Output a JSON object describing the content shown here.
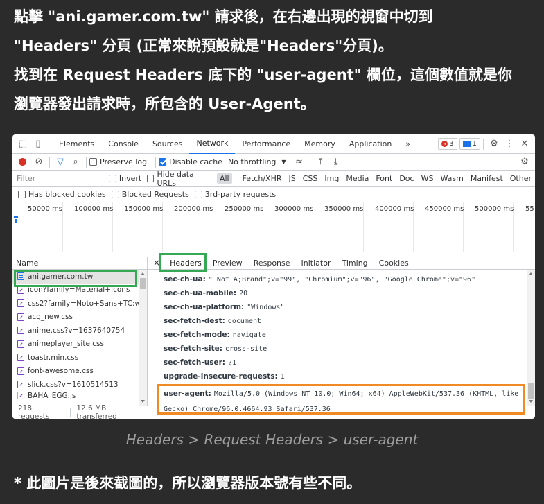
{
  "instructions": [
    "點擊 \"ani.gamer.com.tw\" 請求後，在右邊出現的視窗中切到",
    "\"Headers\" 分頁 (正常來說預設就是\"Headers\"分頁)。",
    "找到在 Request Headers 底下的 \"user-agent\" 欄位，這個數值就是你",
    "瀏覽器發出請求時，所包含的 User-Agent。"
  ],
  "devtools": {
    "tabs": [
      "Elements",
      "Console",
      "Sources",
      "Network",
      "Performance",
      "Memory",
      "Application"
    ],
    "more": "»",
    "active_tab": "Network",
    "error_count": "3",
    "message_count": "1",
    "toolbar": {
      "preserve_log": "Preserve log",
      "disable_cache": "Disable cache",
      "throttling": "No throttling"
    },
    "filter": {
      "placeholder": "Filter",
      "invert": "Invert",
      "hide_data_urls": "Hide data URLs",
      "types": [
        "All",
        "Fetch/XHR",
        "JS",
        "CSS",
        "Img",
        "Media",
        "Font",
        "Doc",
        "WS",
        "Wasm",
        "Manifest",
        "Other"
      ]
    },
    "blocked": {
      "blocked_cookies": "Has blocked cookies",
      "blocked_requests": "Blocked Requests",
      "third_party": "3rd-party requests"
    },
    "timeline_ticks": [
      "50000 ms",
      "100000 ms",
      "150000 ms",
      "200000 ms",
      "250000 ms",
      "300000 ms",
      "350000 ms",
      "400000 ms",
      "450000 ms",
      "500000 ms",
      "55"
    ],
    "name_header": "Name",
    "files": [
      {
        "name": "ani.gamer.com.tw",
        "kind": "doc"
      },
      {
        "name": "icon?family=Material+Icons",
        "kind": "css"
      },
      {
        "name": "css2?family=Noto+Sans+TC:wg",
        "kind": "css"
      },
      {
        "name": "acg_new.css",
        "kind": "css"
      },
      {
        "name": "anime.css?v=1637640754",
        "kind": "css"
      },
      {
        "name": "animeplayer_site.css",
        "kind": "css"
      },
      {
        "name": "toastr.min.css",
        "kind": "css"
      },
      {
        "name": "font-awesome.css",
        "kind": "css"
      },
      {
        "name": "slick.css?v=1610514513",
        "kind": "css"
      },
      {
        "name": "BAHA_EGG.js",
        "kind": "css"
      }
    ],
    "status": {
      "requests": "218 requests",
      "transferred": "12.6 MB transferred"
    },
    "detail_close": "×",
    "detail_tabs": [
      "Headers",
      "Preview",
      "Response",
      "Initiator",
      "Timing",
      "Cookies"
    ],
    "headers": [
      {
        "key": "sec-ch-ua:",
        "value": "\" Not A;Brand\";v=\"99\", \"Chromium\";v=\"96\", \"Google Chrome\";v=\"96\""
      },
      {
        "key": "sec-ch-ua-mobile:",
        "value": "?0"
      },
      {
        "key": "sec-ch-ua-platform:",
        "value": "\"Windows\""
      },
      {
        "key": "sec-fetch-dest:",
        "value": "document"
      },
      {
        "key": "sec-fetch-mode:",
        "value": "navigate"
      },
      {
        "key": "sec-fetch-site:",
        "value": "cross-site"
      },
      {
        "key": "sec-fetch-user:",
        "value": "?1"
      },
      {
        "key": "upgrade-insecure-requests:",
        "value": "1"
      }
    ],
    "user_agent": {
      "key": "user-agent:",
      "value": "Mozilla/5.0 (Windows NT 10.0; Win64; x64) AppleWebKit/537.36 (KHTML, like Gecko) Chrome/96.0.4664.93 Safari/537.36"
    }
  },
  "caption": "Headers > Request Headers > user-agent",
  "note": "* 此圖片是後來截圖的，所以瀏覽器版本號有些不同。"
}
